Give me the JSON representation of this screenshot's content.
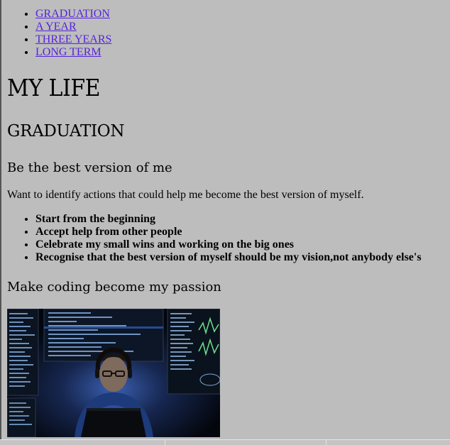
{
  "nav": [
    {
      "label": "GRADUATION"
    },
    {
      "label": "A YEAR"
    },
    {
      "label": "THREE YEARS"
    },
    {
      "label": "LONG TERM"
    }
  ],
  "title": "MY LIFE",
  "section": {
    "heading": "GRADUATION",
    "subheading": "Be the best version of me",
    "intro": "Want to identify actions that could help me become the best version of myself.",
    "goals": [
      "Start from the beginning",
      "Accept help from other people",
      "Celebrate my small wins and working on the big ones",
      "Recognise that the best version of myself should be my vision,not anybody else's"
    ],
    "subheading2": "Make coding become my passion"
  },
  "colors": {
    "background": "#bdbdbd",
    "link": "#5522dd"
  },
  "icons": {
    "photo": "coder-at-laptop-image"
  }
}
